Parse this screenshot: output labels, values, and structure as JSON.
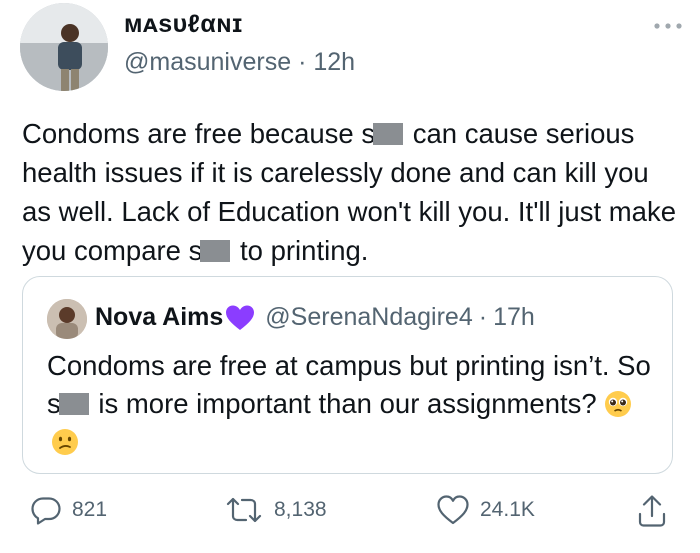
{
  "tweet": {
    "display_name": "ᴍᴀѕυℓαɴɪ",
    "handle": "@masuniverse",
    "separator": "·",
    "time": "12h",
    "text_parts": [
      "Condoms are free because s",
      " can cause serious health issues if it is carelessly done and can kill you as well. Lack of Education won't kill you. It'll just make you compare s",
      " to printing."
    ]
  },
  "quoted": {
    "name": "Nova Aims",
    "handle": "@SerenaNdagire4",
    "separator": "·",
    "time": "17h",
    "text_parts": [
      "Condoms are free at campus but printing isn’t. So s",
      " is more important than our assignments?"
    ]
  },
  "stats": {
    "replies": "821",
    "retweets": "8,138",
    "likes": "24.1K"
  },
  "colors": {
    "text": "#0f1419",
    "secondary": "#536471",
    "border": "#cfd9de",
    "verified_heart": "#8b3dff"
  },
  "icons": [
    "more-icon",
    "purple-heart-icon",
    "pleading-face-emoji",
    "confused-face-emoji",
    "reply-icon",
    "retweet-icon",
    "like-icon",
    "share-icon"
  ]
}
